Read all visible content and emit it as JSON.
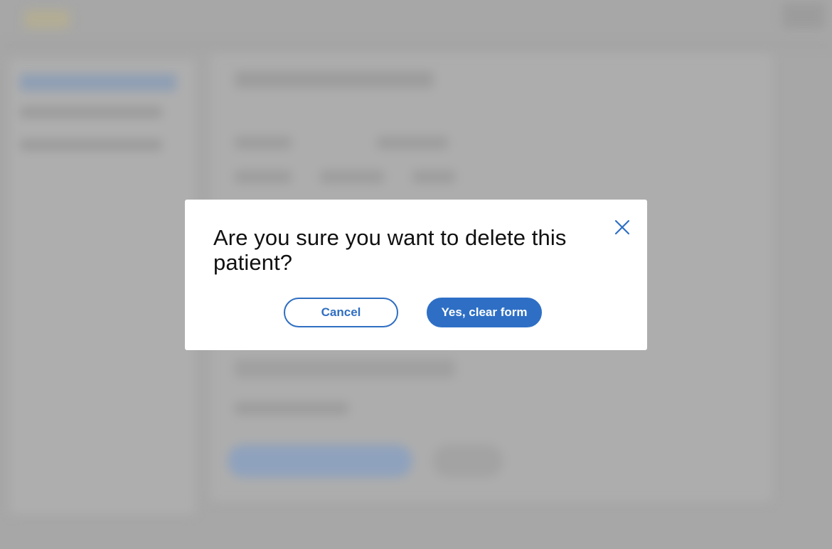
{
  "dialog": {
    "title": "Are you sure you want to delete this patient?",
    "cancel_label": "Cancel",
    "confirm_label": "Yes, clear form",
    "close_icon": "close-icon"
  },
  "colors": {
    "overlay": "#a7a7a7",
    "accent": "#2e6fc5",
    "dialog_bg": "#ffffff",
    "title_text": "#111111"
  }
}
